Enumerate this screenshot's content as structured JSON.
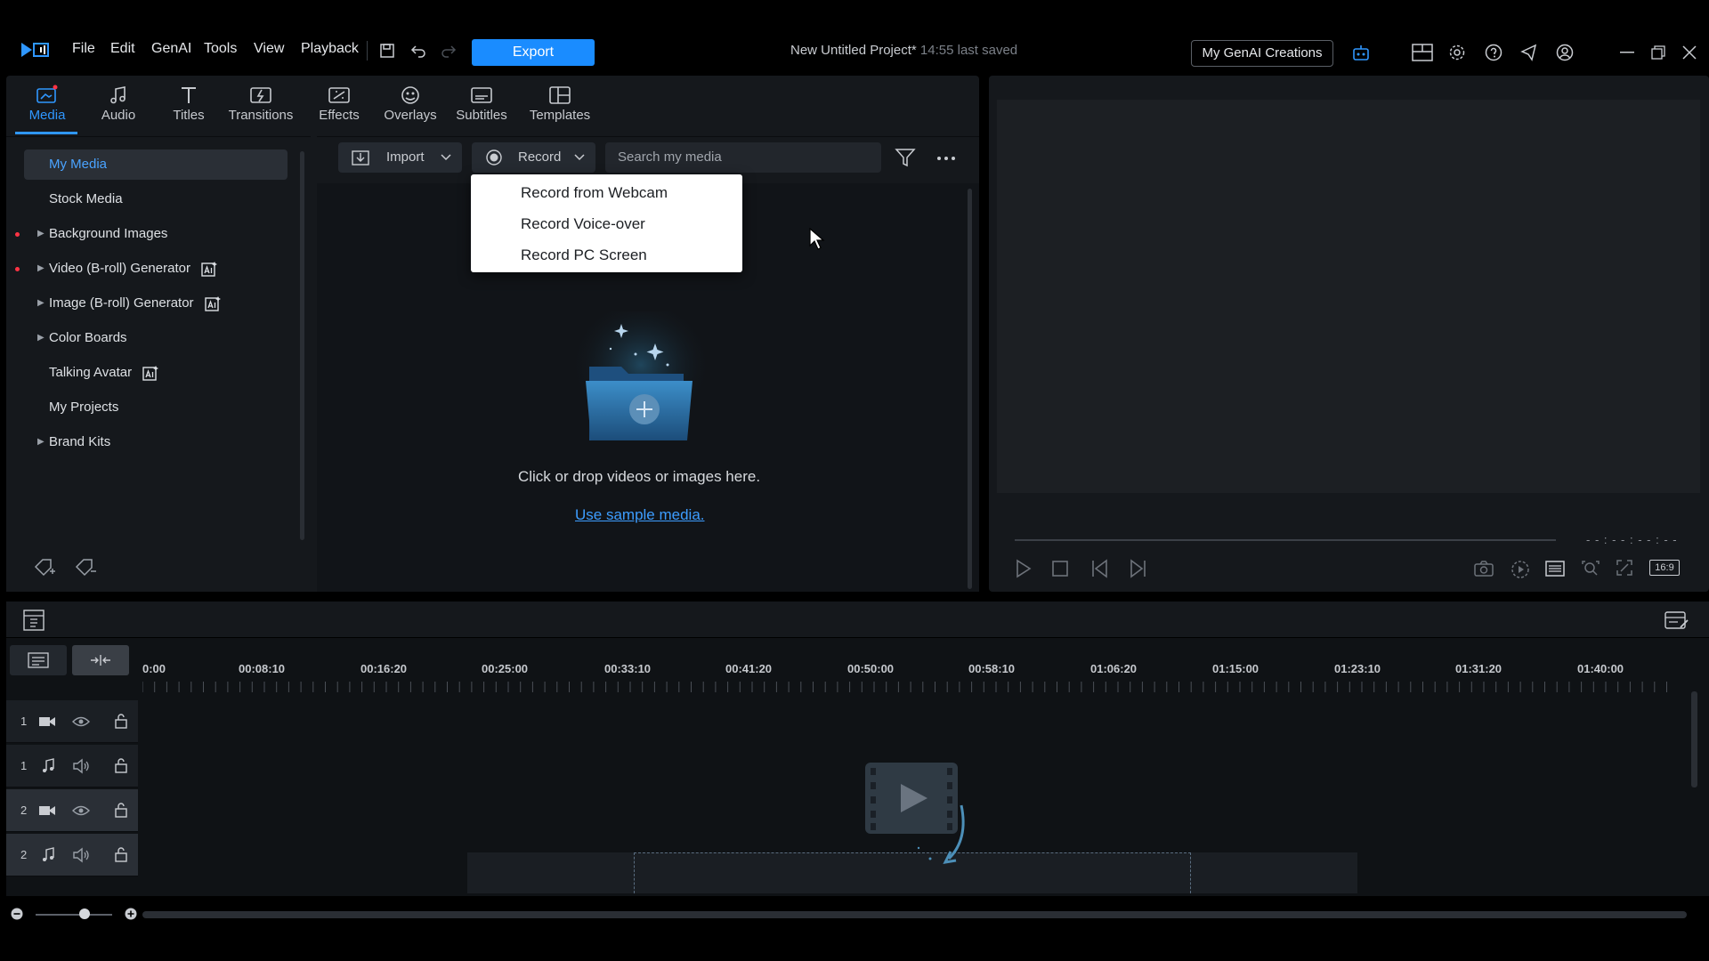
{
  "titlebar": {
    "menu": [
      "File",
      "Edit",
      "GenAI",
      "Tools",
      "View",
      "Playback"
    ],
    "export_label": "Export",
    "project_title": "New Untitled Project*",
    "last_saved": "14:55 last saved",
    "genai_creations": "My GenAI Creations"
  },
  "tabs": [
    {
      "label": "Media",
      "icon": "media-icon",
      "active": true
    },
    {
      "label": "Audio",
      "icon": "music-note-icon"
    },
    {
      "label": "Titles",
      "icon": "text-t-icon"
    },
    {
      "label": "Transitions",
      "icon": "transitions-icon"
    },
    {
      "label": "Effects",
      "icon": "effects-icon"
    },
    {
      "label": "Overlays",
      "icon": "overlays-icon"
    },
    {
      "label": "Subtitles",
      "icon": "subtitles-icon"
    },
    {
      "label": "Templates",
      "icon": "templates-icon"
    }
  ],
  "sidebar": {
    "items": [
      {
        "label": "My Media",
        "selected": true
      },
      {
        "label": "Stock Media"
      },
      {
        "label": "Background Images",
        "expandable": true,
        "new": true
      },
      {
        "label": "Video (B-roll) Generator",
        "expandable": true,
        "new": true,
        "ai": true
      },
      {
        "label": "Image (B-roll) Generator",
        "expandable": true,
        "ai": true
      },
      {
        "label": "Color Boards",
        "expandable": true
      },
      {
        "label": "Talking Avatar",
        "ai": true
      },
      {
        "label": "My Projects"
      },
      {
        "label": "Brand Kits",
        "expandable": true
      }
    ]
  },
  "toolbar": {
    "import_label": "Import",
    "record_label": "Record",
    "search_placeholder": "Search my media"
  },
  "record_menu": [
    "Record from Webcam",
    "Record Voice-over",
    "Record PC Screen"
  ],
  "empty_state": {
    "prompt": "Click or drop videos or images here.",
    "sample_link": "Use sample media."
  },
  "preview": {
    "timecode": "- - : - - : - - : - -",
    "aspect": "16:9"
  },
  "timeline": {
    "ruler": [
      "0:00",
      "00:08:10",
      "00:16:20",
      "00:25:00",
      "00:33:10",
      "00:41:20",
      "00:50:00",
      "00:58:10",
      "01:06:20",
      "01:15:00",
      "01:23:10",
      "01:31:20",
      "01:40:00"
    ],
    "tracks": [
      {
        "num": "1",
        "type": "video"
      },
      {
        "num": "1",
        "type": "audio"
      },
      {
        "num": "2",
        "type": "video"
      },
      {
        "num": "2",
        "type": "audio"
      }
    ]
  },
  "colors": {
    "accent": "#1a8cff",
    "panel": "#15181c",
    "new_dot": "#ff3344"
  }
}
